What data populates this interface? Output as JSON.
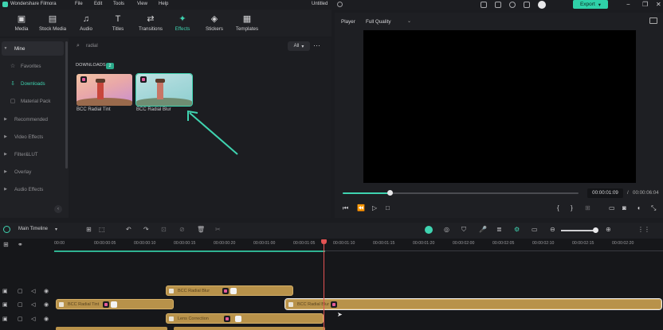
{
  "app": {
    "title": "Wondershare Filmora",
    "menu": [
      "File",
      "Edit",
      "Tools",
      "View",
      "Help"
    ],
    "project_name": "Untitled",
    "export_label": "Export"
  },
  "toolbar": {
    "tabs": [
      {
        "label": "Media",
        "icon": "media-icon"
      },
      {
        "label": "Stock Media",
        "icon": "stock-media-icon"
      },
      {
        "label": "Audio",
        "icon": "music-note-icon"
      },
      {
        "label": "Titles",
        "icon": "text-icon"
      },
      {
        "label": "Transitions",
        "icon": "transitions-icon"
      },
      {
        "label": "Effects",
        "icon": "sparkle-icon",
        "active": true
      },
      {
        "label": "Stickers",
        "icon": "sticker-icon"
      },
      {
        "label": "Templates",
        "icon": "templates-icon"
      }
    ]
  },
  "sidebar": {
    "items": [
      {
        "label": "Mine",
        "expanded": true
      },
      {
        "label": "Favorites",
        "icon": "star-icon"
      },
      {
        "label": "Downloads",
        "icon": "download-icon",
        "selected": true
      },
      {
        "label": "Material Pack",
        "icon": "box-icon"
      },
      {
        "label": "Recommended"
      },
      {
        "label": "Video Effects"
      },
      {
        "label": "Filter&LUT"
      },
      {
        "label": "Overlay"
      },
      {
        "label": "Audio Effects"
      }
    ]
  },
  "search": {
    "value": "radial",
    "filter": "All"
  },
  "downloads": {
    "header": "DOWNLOADS",
    "count": "2",
    "items": [
      {
        "label": "BCC Radial Tint"
      },
      {
        "label": "BCC Radial Blur",
        "selected": true
      }
    ]
  },
  "player": {
    "label": "Player",
    "quality": "Full Quality",
    "progress": 0.2,
    "current_time": "00:00:01:09",
    "separator": "/",
    "total_time": "00:00:06:04"
  },
  "timeline": {
    "label": "Main Timeline",
    "ticks": [
      "00:00",
      "00:00:00:05",
      "00:00:00:10",
      "00:00:00:15",
      "00:00:00:20",
      "00:00:01:00",
      "00:00:01:05",
      "00:00:01:10",
      "00:00:01:15",
      "00:00:01:20",
      "00:00:02:00",
      "00:00:02:05",
      "00:00:02:10",
      "00:00:02:15",
      "00:00:02:20"
    ],
    "clips": [
      {
        "label": "BCC Radial Blur",
        "track": 1
      },
      {
        "label": "BCC Radial Tint",
        "track": 2
      },
      {
        "label": "BCC Radial Blur",
        "track": 2
      },
      {
        "label": "Lens Correction",
        "track": 3
      }
    ]
  },
  "colors": {
    "accent": "#3fd3b0",
    "playhead": "#e45353",
    "clip": "#b8924a"
  }
}
